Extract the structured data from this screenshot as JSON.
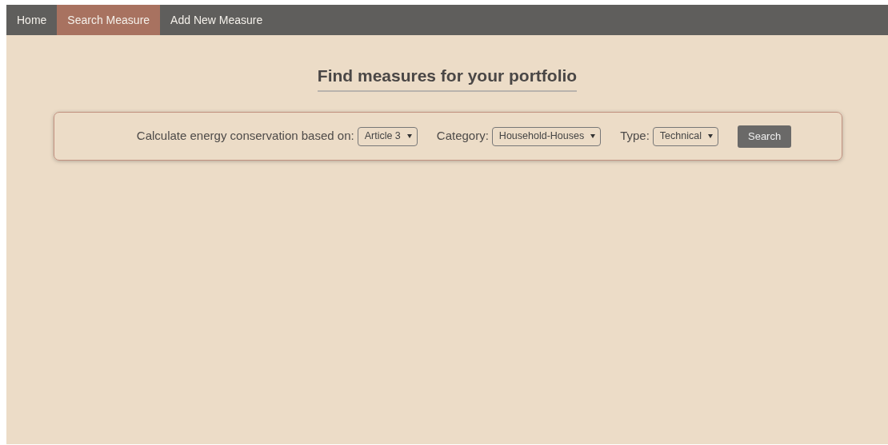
{
  "nav": [
    {
      "label": "Home",
      "selected": false
    },
    {
      "label": "Search Measure",
      "selected": true
    },
    {
      "label": "Add New Measure",
      "selected": false
    }
  ],
  "title": "Find measures for your portfolio",
  "filters": [
    {
      "label": "Calculate energy conservation based on:",
      "value": "Article 3"
    },
    {
      "label": "Category:",
      "value": "Household-Houses"
    },
    {
      "label": "Type:",
      "value": "Technical"
    }
  ],
  "search_button": "Search"
}
